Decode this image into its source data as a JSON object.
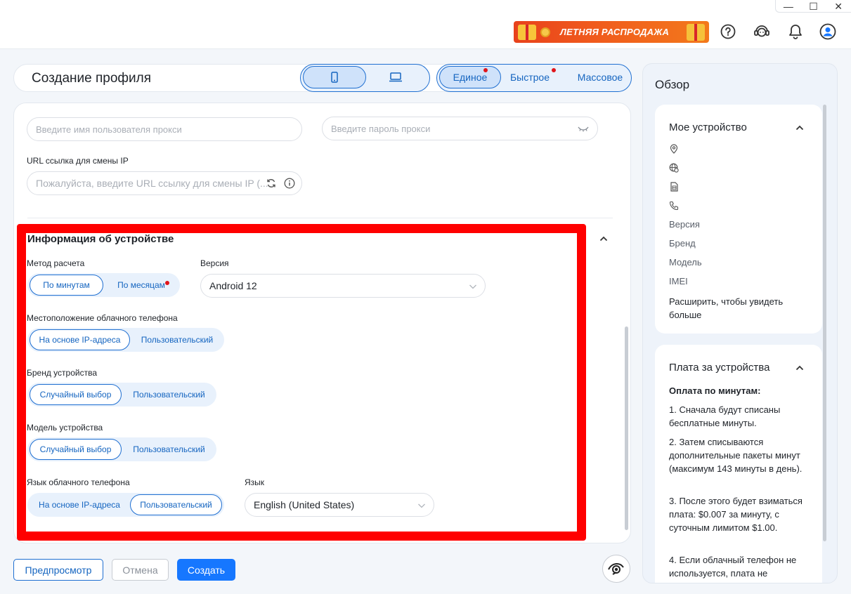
{
  "window": {
    "minimize": "—",
    "maximize": "☐",
    "close": "✕"
  },
  "promo": {
    "text": "ЛЕТНЯЯ РАСПРОДАЖА"
  },
  "topicons": [
    "help-icon",
    "support-icon",
    "bell-icon",
    "user-icon"
  ],
  "header": {
    "title": "Создание профиля",
    "device_types": [
      "phone-icon",
      "laptop-icon"
    ],
    "modes": [
      "Единое",
      "Быстрое",
      "Массовое"
    ]
  },
  "proxy": {
    "username_placeholder": "Введите имя пользователя прокси",
    "password_placeholder": "Введите пароль прокси",
    "url_label": "URL ссылка для смены IP",
    "url_placeholder": "Пожалуйста, введите URL ссылку для смены IP (..."
  },
  "device_info": {
    "title": "Информация об устройстве",
    "billing": {
      "label": "Метод расчета",
      "options": [
        "По минутам",
        "По месяцам"
      ]
    },
    "version": {
      "label": "Версия",
      "value": "Android 12"
    },
    "location": {
      "label": "Местоположение облачного телефона",
      "options": [
        "На основе IP-адреса",
        "Пользовательский"
      ]
    },
    "brand": {
      "label": "Бренд устройства",
      "options": [
        "Случайный выбор",
        "Пользовательский"
      ]
    },
    "model": {
      "label": "Модель устройства",
      "options": [
        "Случайный выбор",
        "Пользовательский"
      ]
    },
    "phone_language": {
      "label": "Язык облачного телефона",
      "options": [
        "На основе IP-адреса",
        "Пользовательский"
      ]
    },
    "language": {
      "label": "Язык",
      "value": "English (United States)"
    }
  },
  "footer": {
    "preview": "Предпросмотр",
    "cancel": "Отмена",
    "create": "Создать"
  },
  "overview": {
    "title": "Обзор",
    "my_device": {
      "title": "Мое устройство",
      "icons": [
        "location-icon",
        "globe-icon",
        "sim-icon",
        "phone-call-icon"
      ],
      "rows": [
        "Версия",
        "Бренд",
        "Модель",
        "IMEI"
      ],
      "expand": "Расширить, чтобы увидеть больше"
    },
    "fee": {
      "title": "Плата за устройства",
      "subtitle": "Оплата по минутам:",
      "p1": "1. Сначала будут списаны бесплатные минуты.",
      "p2": "2. Затем списываются дополнительные пакеты минут (максимум 143 минуты в день).",
      "p3": "3. После этого будет взиматься плата: $0.007 за минуту, с суточным лимитом $1.00.",
      "p4": "4. Если облачный телефон не используется, плата не"
    }
  },
  "colors": {
    "accent": "#1677ff",
    "highlight": "#ff0000",
    "badge": "#e0151b"
  }
}
